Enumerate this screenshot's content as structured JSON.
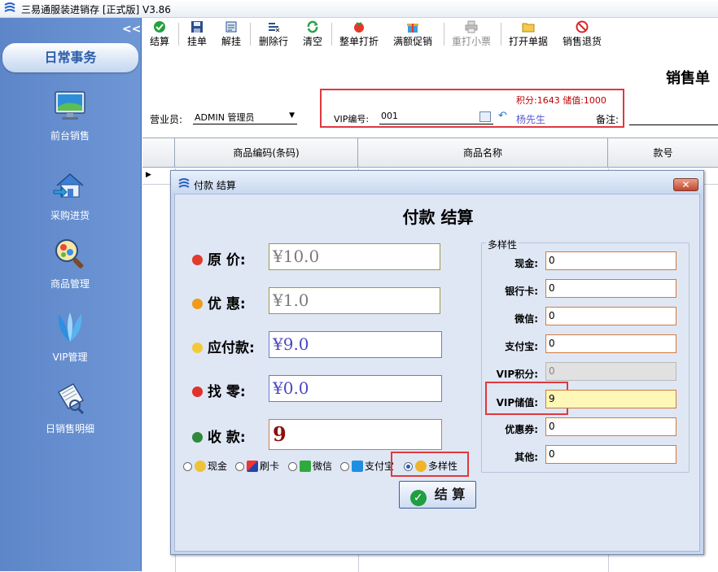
{
  "app": {
    "title": "三易通服装进销存 [正式版] V3.86"
  },
  "sidebar": {
    "collapse": "<<",
    "section": "日常事务",
    "items": [
      {
        "label": "前台销售",
        "icon": "monitor-icon"
      },
      {
        "label": "采购进货",
        "icon": "house-icon"
      },
      {
        "label": "商品管理",
        "icon": "magnifier-icon"
      },
      {
        "label": "VIP管理",
        "icon": "vip-icon"
      },
      {
        "label": "日销售明细",
        "icon": "report-icon"
      }
    ]
  },
  "toolbar": {
    "items": [
      {
        "label": "结算",
        "icon": "checkmark-icon"
      },
      {
        "label": "挂单",
        "icon": "save-icon"
      },
      {
        "label": "解挂",
        "icon": "unhang-icon"
      },
      {
        "label": "删除行",
        "icon": "delete-row-icon"
      },
      {
        "label": "清空",
        "icon": "refresh-icon"
      },
      {
        "label": "整单打折",
        "icon": "tomato-icon"
      },
      {
        "label": "满额促销",
        "icon": "gift-icon"
      },
      {
        "label": "重打小票",
        "icon": "printer-icon"
      },
      {
        "label": "打开单据",
        "icon": "folder-icon"
      },
      {
        "label": "销售退货",
        "icon": "return-icon"
      }
    ]
  },
  "form": {
    "title": "销售单",
    "clerk_label": "营业员:",
    "clerk_value": "ADMIN 管理员",
    "points_info": "积分:1643 储值:1000",
    "vip_label": "VIP编号:",
    "vip_value": "001",
    "vip_name": "杨先生",
    "remark_label": "备注:"
  },
  "grid": {
    "columns": [
      "商品编码(条码)",
      "商品名称",
      "款号"
    ],
    "row_indicator": "▶"
  },
  "dialog": {
    "title": "付款 结算",
    "heading": "付款 结算",
    "close": "✕",
    "fields": {
      "original_label": "原  价:",
      "original_value": "¥10.0",
      "discount_label": "优  惠:",
      "discount_value": "¥1.0",
      "payable_label": "应付款:",
      "payable_value": "¥9.0",
      "change_label": "找  零:",
      "change_value": "¥0.0",
      "received_label": "收  款:",
      "received_value": "9"
    },
    "payment_options": [
      {
        "label": "现金",
        "selected": false
      },
      {
        "label": "刷卡",
        "selected": false
      },
      {
        "label": "微信",
        "selected": false
      },
      {
        "label": "支付宝",
        "selected": false
      },
      {
        "label": "多样性",
        "selected": true
      }
    ],
    "settle_button": "结 算",
    "multi": {
      "legend": "多样性",
      "rows": [
        {
          "label": "现金:",
          "value": "0"
        },
        {
          "label": "银行卡:",
          "value": "0"
        },
        {
          "label": "微信:",
          "value": "0"
        },
        {
          "label": "支付宝:",
          "value": "0"
        },
        {
          "label": "VIP积分:",
          "value": "0"
        },
        {
          "label": "VIP储值:",
          "value": "9"
        },
        {
          "label": "优惠券:",
          "value": "0"
        },
        {
          "label": "其他:",
          "value": "0"
        }
      ]
    }
  },
  "colors": {
    "highlight_border": "#e0393e",
    "sidebar": "#6a91d2",
    "input_border": "#d17a3c"
  }
}
